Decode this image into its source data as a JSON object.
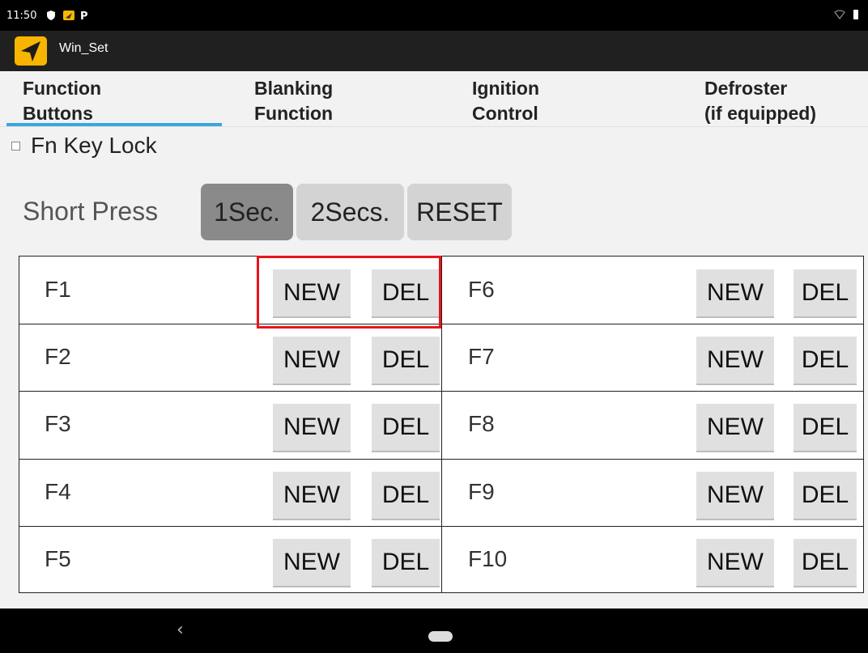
{
  "status_bar": {
    "time": "11:50"
  },
  "app": {
    "title": "Win_Set"
  },
  "tabs": [
    {
      "label": "Function\nButtons",
      "active": true
    },
    {
      "label": "Blanking\nFunction",
      "active": false
    },
    {
      "label": "Ignition\nControl",
      "active": false
    },
    {
      "label": "Defroster\n(if equipped)",
      "active": false
    }
  ],
  "fn_key_lock": {
    "label": "Fn Key Lock",
    "checked": false
  },
  "short_press": {
    "label": "Short Press",
    "options": [
      "1Sec.",
      "2Secs.",
      "RESET"
    ],
    "selected": "1Sec."
  },
  "function_keys": {
    "left": [
      "F1",
      "F2",
      "F3",
      "F4",
      "F5"
    ],
    "right": [
      "F6",
      "F7",
      "F8",
      "F9",
      "F10"
    ],
    "new_label": "NEW",
    "del_label": "DEL"
  },
  "colors": {
    "tab_underline": "#3aa6e0",
    "highlight_box": "#e8141b",
    "selected_button": "#8a8a8a"
  }
}
